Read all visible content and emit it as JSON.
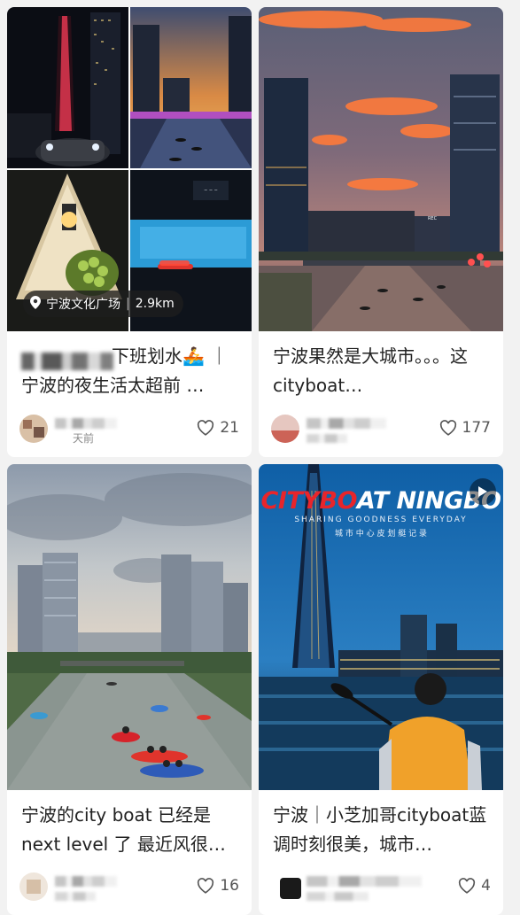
{
  "feed": {
    "cards": [
      {
        "title": "下班划水🚣｜宁波的夜生活太超前 …",
        "title_visible": "下班划水🚣 ｜\n宁波的夜生活太超前 …",
        "location": "宁波文化广场",
        "distance": "2.9km",
        "time_text": "天前",
        "likes": "21"
      },
      {
        "title": "宁波果然是大城市。。。这cityboat…",
        "likes": "177"
      },
      {
        "title": "宁波的city boat 已经是next level 了 最近风很…",
        "likes": "16"
      },
      {
        "title": "宁波｜小芝加哥cityboat蓝调时刻很美，城市…",
        "cover_headline": "CITYBOAT NINGBO",
        "cover_tagline": "SHARING GOODNESS EVERYDAY",
        "cover_subtitle": "城 市 中 心 皮 划 艇 记 录",
        "likes": "4"
      }
    ]
  },
  "colors": {
    "page_bg": "#f2f2f2",
    "card_bg": "#ffffff",
    "text": "#222222",
    "muted": "#8a8a8a",
    "pill_bg": "#1e1e1e",
    "headline_red": "#e8252b"
  }
}
